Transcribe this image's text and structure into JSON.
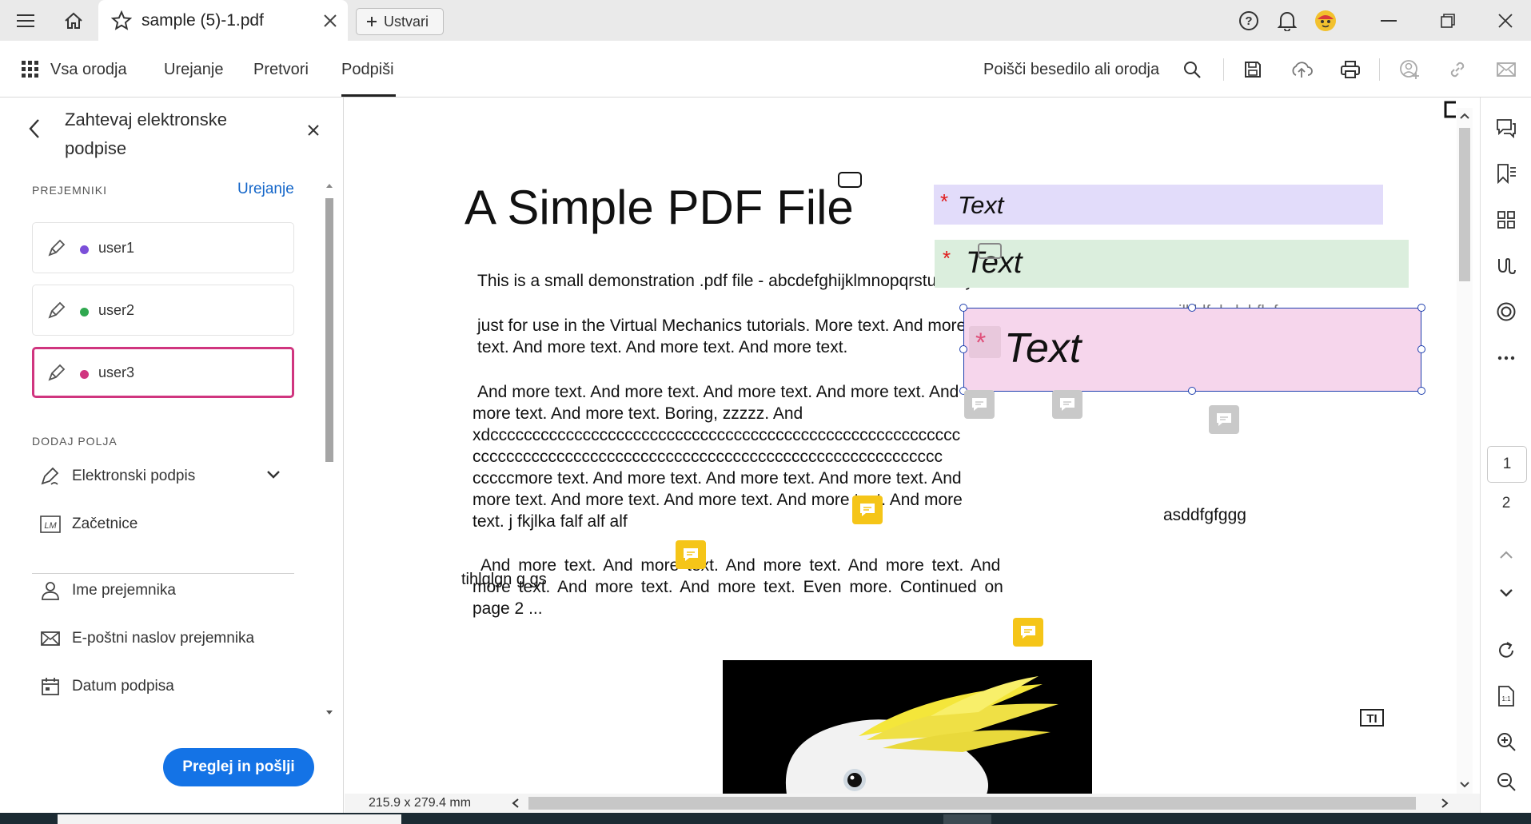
{
  "titlebar": {
    "tab_title": "sample (5)-1.pdf",
    "create_label": "Ustvari",
    "icons": [
      "hamburger-menu-icon",
      "home-icon",
      "star-icon",
      "close-icon",
      "plus-icon",
      "help-icon",
      "bell-icon",
      "avatar",
      "minimize-icon",
      "restore-icon",
      "window-close-icon"
    ]
  },
  "menubar": {
    "all_tools": "Vsa orodja",
    "items": [
      "Urejanje",
      "Pretvori",
      "Podpiši"
    ],
    "active": "Podpiši",
    "search_label": "Poišči besedilo ali orodja"
  },
  "left_panel": {
    "title": "Zahtevaj elektronske podpise",
    "recipients_label": "PREJEMNIKI",
    "edit_link": "Urejanje",
    "recipients": [
      {
        "name": "user1",
        "color": "#7b4fd9"
      },
      {
        "name": "user2",
        "color": "#2fa84f"
      },
      {
        "name": "user3",
        "color": "#d0357f"
      }
    ],
    "add_fields_label": "DODAJ POLJA",
    "fields": [
      "Elektronski podpis",
      "Začetnice",
      "Ime prejemnika",
      "E-poštni naslov prejemnika",
      "Datum podpisa"
    ],
    "send_button": "Preglej in pošlji"
  },
  "document": {
    "title": "A Simple PDF File",
    "paragraphs": [
      "This is a small demonstration .pdf file - abcdefghijklmnopqrstuvwxyz",
      "just for use in the Virtual Mechanics tutorials. More text. And more",
      "text. And more text. And more text. And more text.",
      "And more text. And more text. And more text. And more text. And",
      "more  text. And more text. Boring, zzzzz. And",
      "xdcccccccccccccccccccccccccccccccccccccccccccccccccccccccc",
      "cccccccccccccccccccccccccccccccccccccccccccccccccccccccc",
      "cccccmore text. And more text. And  more text. And more text. And",
      "more text. And more text. And more text.  And more text. And more",
      "text. j fkjlka falf alf alf",
      "And more text. And more text. And more text. And more text. And",
      "more  text. And more text. And more text. Even more. Continued on",
      "page 2 ..."
    ],
    "overlay_text_1": "tihlqlgn g gs",
    "overlay_text_2": "jlkhlfnl vlahfk f",
    "overlay_text_3": "asddfgfggg",
    "text_fields": [
      {
        "label": "Text",
        "color": "#e2dcfa"
      },
      {
        "label": "Text",
        "color": "#dbeedd"
      },
      {
        "label": "Text",
        "color": "#f6d6ec"
      }
    ],
    "required_mark": "*",
    "page_size": "215.9 x 279.4 mm"
  },
  "right_rail": {
    "current_page": "1",
    "next_page": "2",
    "icons": [
      "comment-icon",
      "bookmark-icon",
      "thumbnails-icon",
      "signature-icon",
      "stamp-icon",
      "more-icon",
      "page-up-icon",
      "page-down-icon",
      "rotate-icon",
      "fit-page-icon",
      "zoom-in-icon",
      "zoom-out-icon"
    ]
  }
}
